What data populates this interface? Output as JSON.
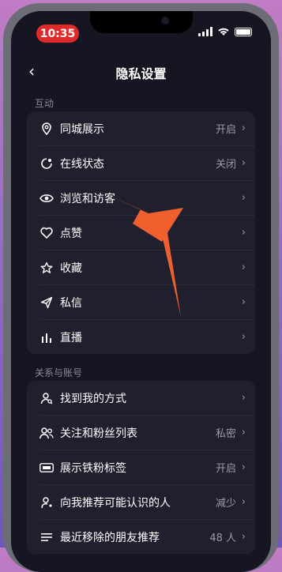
{
  "status_bar": {
    "time": "10:35",
    "accent": "#e02a2a"
  },
  "header": {
    "back_label": "‹",
    "title": "隐私设置"
  },
  "sections": [
    {
      "label": "互动",
      "items": [
        {
          "label": "同城展示",
          "value": "开启",
          "icon": "location-pin-icon"
        },
        {
          "label": "在线状态",
          "value": "关闭",
          "icon": "online-status-icon"
        },
        {
          "label": "浏览和访客",
          "value": "",
          "icon": "eye-icon"
        },
        {
          "label": "点赞",
          "value": "",
          "icon": "heart-icon"
        },
        {
          "label": "收藏",
          "value": "",
          "icon": "star-icon"
        },
        {
          "label": "私信",
          "value": "",
          "icon": "send-icon"
        },
        {
          "label": "直播",
          "value": "",
          "icon": "bars-icon"
        }
      ]
    },
    {
      "label": "关系与账号",
      "items": [
        {
          "label": "找到我的方式",
          "value": "",
          "icon": "user-search-icon"
        },
        {
          "label": "关注和粉丝列表",
          "value": "私密",
          "icon": "users-icon"
        },
        {
          "label": "展示铁粉标签",
          "value": "开启",
          "icon": "fan-badge-icon"
        },
        {
          "label": "向我推荐可能认识的人",
          "value": "减少",
          "icon": "recommend-icon"
        },
        {
          "label": "最近移除的朋友推荐",
          "value": "48 人",
          "icon": "list-icon"
        }
      ]
    }
  ],
  "chevron": "›",
  "annotation_color": "#f0602e"
}
